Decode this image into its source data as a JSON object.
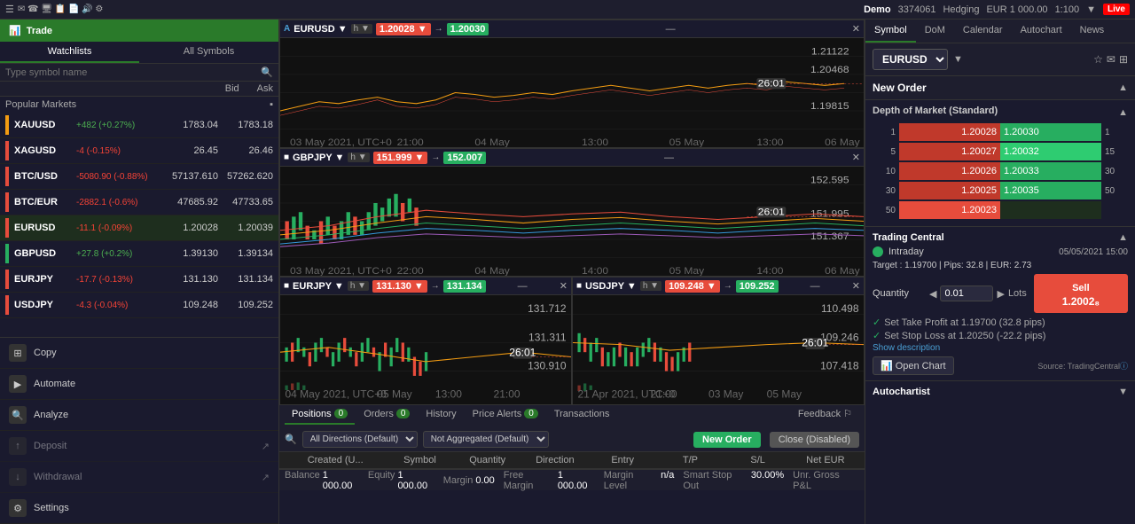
{
  "topbar": {
    "demo_label": "Demo",
    "account_number": "3374061",
    "hedging_label": "Hedging",
    "currency": "EUR 1 000.00",
    "leverage": "1:100",
    "live_label": "Live"
  },
  "sidebar": {
    "title": "Trade",
    "tabs": [
      {
        "label": "Watchlists"
      },
      {
        "label": "All Symbols"
      }
    ],
    "search_placeholder": "Type symbol name",
    "columns": {
      "bid": "Bid",
      "ask": "Ask"
    },
    "popular_markets_label": "Popular Markets",
    "markets": [
      {
        "name": "XAUUSD",
        "change": "+482 (+0.27%)",
        "change_type": "pos",
        "bid": "1783.04",
        "ask": "1783.18"
      },
      {
        "name": "XAGUSD",
        "change": "-4 (-0.15%)",
        "change_type": "neg",
        "bid": "26.45",
        "ask": "26.46"
      },
      {
        "name": "BTC/USD",
        "change": "-5080.90 (-0.88%)",
        "change_type": "neg",
        "bid": "57137.610",
        "ask": "57262.620"
      },
      {
        "name": "BTC/EUR",
        "change": "-2882.1 (-0.6%)",
        "change_type": "neg",
        "bid": "47685.92",
        "ask": "47733.65"
      },
      {
        "name": "EURUSD",
        "change": "-11.1 (-0.09%)",
        "change_type": "neg",
        "bid": "1.20028",
        "ask": "1.20039"
      },
      {
        "name": "GBPUSD",
        "change": "+27.8 (+0.2%)",
        "change_type": "pos",
        "bid": "1.39130",
        "ask": "1.39134"
      },
      {
        "name": "EURJPY",
        "change": "-17.7 (-0.13%)",
        "change_type": "neg",
        "bid": "131.130",
        "ask": "131.134"
      },
      {
        "name": "USDJPY",
        "change": "-4.3 (-0.04%)",
        "change_type": "neg",
        "bid": "109.248",
        "ask": "109.252"
      }
    ],
    "menu_items": [
      {
        "label": "Copy",
        "icon": "copy-icon"
      },
      {
        "label": "Automate",
        "icon": "automate-icon"
      },
      {
        "label": "Analyze",
        "icon": "analyze-icon"
      },
      {
        "label": "Deposit",
        "icon": "deposit-icon"
      },
      {
        "label": "Withdrawal",
        "icon": "withdrawal-icon"
      },
      {
        "label": "Settings",
        "icon": "settings-icon"
      }
    ]
  },
  "charts": [
    {
      "id": "eurusd-chart",
      "symbol": "EURUSD",
      "timeframe": "h",
      "bid_price": "1.20028",
      "ask_price": "1.20030",
      "full_width": true
    },
    {
      "id": "gbpjpy-chart",
      "symbol": "GBPJPY",
      "timeframe": "h",
      "bid_price": "151.999",
      "ask_price": "152.007",
      "full_width": true
    },
    {
      "id": "eurjpy-chart",
      "symbol": "EURJPY",
      "timeframe": "h",
      "bid_price": "131.130",
      "ask_price": "131.134",
      "full_width": false
    },
    {
      "id": "usdjpy-chart",
      "symbol": "USDJPY",
      "timeframe": "h",
      "bid_price": "109.248",
      "ask_price": "109.252",
      "full_width": false
    }
  ],
  "positions": {
    "tabs": [
      {
        "label": "Positions",
        "badge": "0",
        "active": true
      },
      {
        "label": "Orders",
        "badge": "0"
      },
      {
        "label": "History"
      },
      {
        "label": "Price Alerts",
        "badge": "0"
      },
      {
        "label": "Transactions"
      },
      {
        "label": "Feedback"
      }
    ],
    "toolbar": {
      "direction_default": "All Directions (Default)",
      "aggregation_default": "Not Aggregated (Default)",
      "new_order_label": "New Order",
      "close_label": "Close (Disabled)"
    },
    "columns": [
      "Created (U...",
      "Symbol",
      "Quantity",
      "Direction",
      "Entry",
      "T/P",
      "S/L",
      "Net EUR"
    ]
  },
  "status_bar": {
    "balance_label": "Balance",
    "balance_value": "1 000.00",
    "equity_label": "Equity",
    "equity_value": "1 000.00",
    "margin_label": "Margin",
    "margin_value": "0.00",
    "free_margin_label": "Free Margin",
    "free_margin_value": "1 000.00",
    "margin_level_label": "Margin Level",
    "margin_level_value": "n/a",
    "smart_stop_label": "Smart Stop Out",
    "smart_stop_value": "30.00%",
    "unrealized_label": "Unr. Gross P&L"
  },
  "right_panel": {
    "tabs": [
      "Symbol",
      "DoM",
      "Calendar",
      "Autochart",
      "News"
    ],
    "symbol": "EURUSD",
    "new_order_label": "New Order",
    "dom": {
      "title": "Depth of Market (Standard)",
      "rows": [
        {
          "qty_bid": "1",
          "bid": "1.20028",
          "ask": "1.20030",
          "qty_ask": "1"
        },
        {
          "qty_bid": "5",
          "bid": "1.20027",
          "ask": "1.20032",
          "qty_ask": "15"
        },
        {
          "qty_bid": "10",
          "bid": "1.20026",
          "ask": "1.20033",
          "qty_ask": "30"
        },
        {
          "qty_bid": "30",
          "bid": "1.20025",
          "ask": "1.20035",
          "qty_ask": "50"
        },
        {
          "qty_bid": "50",
          "bid": "1.20023",
          "ask": "",
          "qty_ask": ""
        }
      ]
    },
    "trading_central": {
      "title": "Trading Central",
      "intraday_label": "Intraday",
      "date": "05/05/2021 15:00",
      "target": "Target : 1.19700 | Pips: 32.8 | EUR: 2.73",
      "quantity_label": "Quantity",
      "quantity_value": "0.01",
      "lots_label": "Lots",
      "sell_label": "1.2002₈",
      "sell_btn_label": "Sell",
      "note1": "Set Take Profit at 1.19700 (32.8 pips)",
      "note2": "Set Stop Loss at 1.20250 (-22.2 pips)",
      "show_desc": "Show description",
      "open_chart_label": "Open Chart",
      "source": "Source: TradingCentral"
    },
    "autochartist": {
      "title": "Autochartist"
    }
  }
}
